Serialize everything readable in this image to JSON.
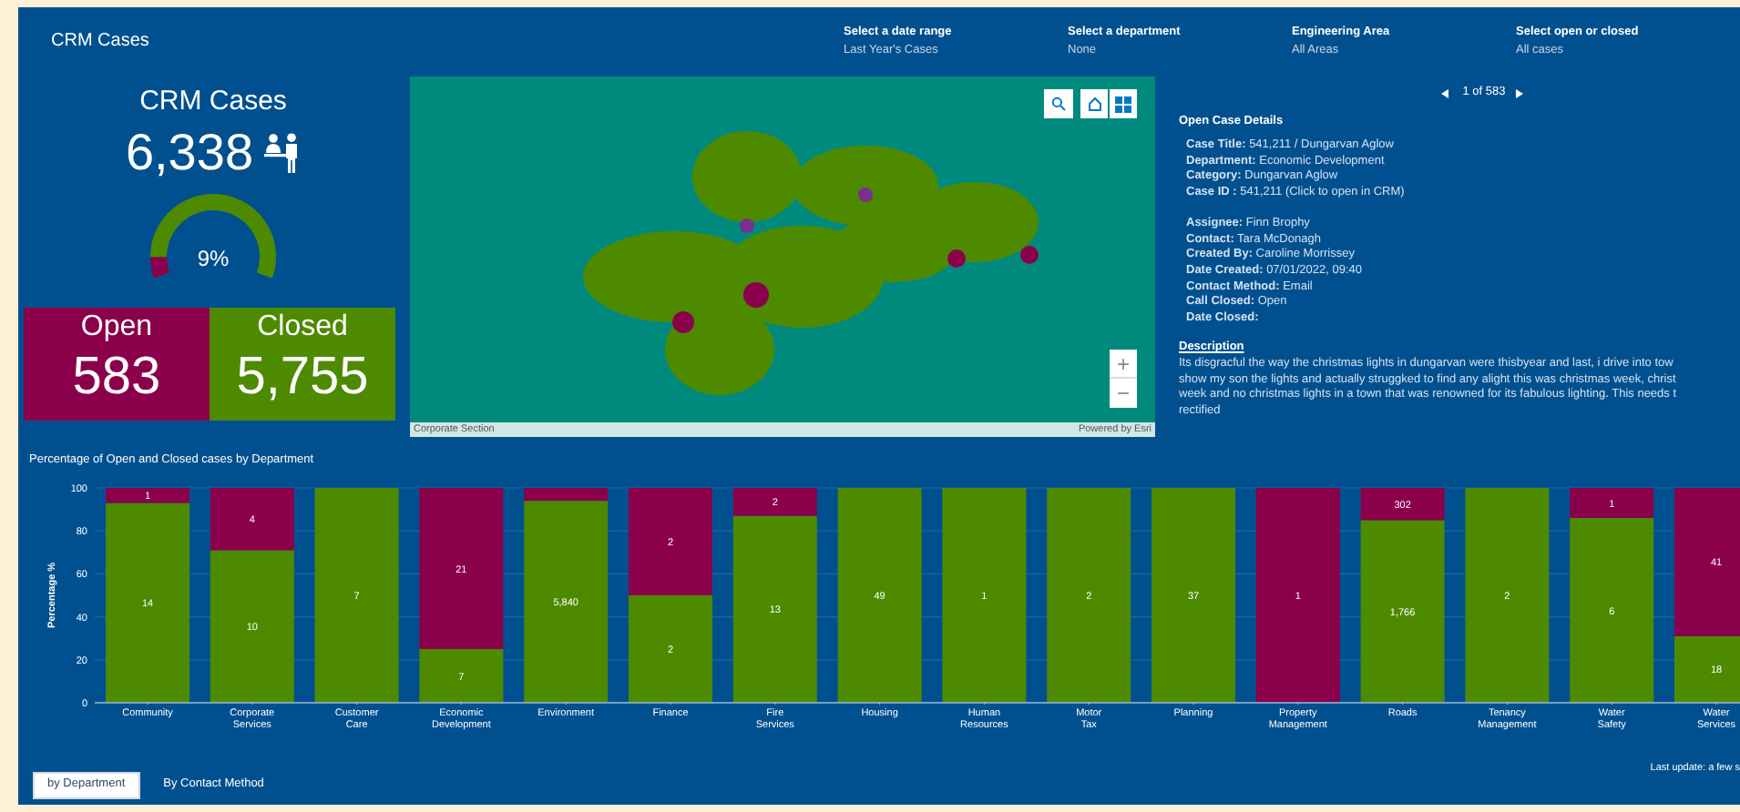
{
  "header": {
    "title": "CRM Cases",
    "filters": [
      {
        "label": "Select a date range",
        "value": "Last Year's Cases"
      },
      {
        "label": "Select a department",
        "value": "None"
      },
      {
        "label": "Engineering Area",
        "value": "All Areas"
      },
      {
        "label": "Select open or closed",
        "value": "All cases"
      }
    ]
  },
  "summary": {
    "title": "CRM Cases",
    "total": "6,338",
    "gauge": {
      "reading": "9%"
    },
    "tiles": [
      {
        "label": "Open",
        "value": "583",
        "color": "#8b004b"
      },
      {
        "label": "Closed",
        "value": "5,755",
        "color": "#4e8a00"
      }
    ]
  },
  "map": {
    "attribution_left": "Corporate Section",
    "attribution_right": "Powered by Esri",
    "zoom_in": "+",
    "zoom_out": "−"
  },
  "details": {
    "pager": "1 of 583",
    "title": "Open Case Details",
    "fields": [
      [
        "**Case Title:** 541,211 / Dungarvan Aglow",
        "**Department:** Economic Development",
        "**Category:** Dungarvan Aglow",
        "**Case ID :** 541,211 (Click to open in CRM)"
      ],
      [
        "**Assignee:** Finn Brophy",
        "**Contact:** Tara McDonagh",
        "**Created By:** Caroline Morrissey",
        "**Date Created:** 07/01/2022, 09:40",
        "**Contact Method:** Email",
        "**Call Closed:** Open",
        "**Date Closed:**"
      ]
    ],
    "description_heading": "Description",
    "description_lines": [
      "Its disgracful the way the christmas lights in dungarvan were thisbyear and last, i drive into tow",
      "show my son the lights and actually struggked to find any alight this was christmas week, christ",
      "week and no christmas lights in a town that was renowned for its fabulous lighting. This needs t",
      "rectified"
    ]
  },
  "chart_title": "Percentage of Open and Closed cases by Department",
  "chart_data": {
    "type": "bar",
    "stacked": true,
    "orientation": "vertical",
    "grid": true,
    "ylabel": "Percentage %",
    "ylim": [
      0,
      100
    ],
    "yticks": [
      0,
      20,
      40,
      60,
      80,
      100
    ],
    "categories": [
      "Community",
      "Corporate Services",
      "Customer Care",
      "Economic Development",
      "Environment",
      "Finance",
      "Fire Services",
      "Housing",
      "Human Resources",
      "Motor Tax",
      "Planning",
      "Property Management",
      "Roads",
      "Tenancy Management",
      "Water Safety",
      "Water Services"
    ],
    "series": [
      {
        "color": "#4e8a00",
        "values": [
          93,
          71,
          100,
          25,
          94,
          50,
          87,
          100,
          100,
          100,
          100,
          0,
          85,
          100,
          86,
          31
        ]
      },
      {
        "color": "#8b004b",
        "values": [
          7,
          29,
          0,
          75,
          6,
          50,
          13,
          0,
          0,
          0,
          0,
          100,
          15,
          0,
          14,
          69
        ]
      }
    ]
  },
  "segment_counts": [
    {
      "upper": "1",
      "lower": "14"
    },
    {
      "upper": "4",
      "lower": "10"
    },
    {
      "lower": "7"
    },
    {
      "upper": "21",
      "lower": "7"
    },
    {
      "lower": "5,840"
    },
    {
      "upper": "2",
      "lower": "2"
    },
    {
      "upper": "2",
      "lower": "13"
    },
    {
      "lower": "49"
    },
    {
      "lower": "1"
    },
    {
      "lower": "2"
    },
    {
      "lower": "37"
    },
    {
      "upper": "1"
    },
    {
      "upper": "302",
      "lower": "1,766"
    },
    {
      "lower": "2"
    },
    {
      "upper": "1",
      "lower": "6"
    },
    {
      "upper": "41",
      "lower": "18"
    }
  ],
  "tabs": [
    {
      "label": "by Department",
      "selected": true
    },
    {
      "label": "By Contact Method",
      "selected": false
    }
  ],
  "last_update": "Last update: a few s"
}
